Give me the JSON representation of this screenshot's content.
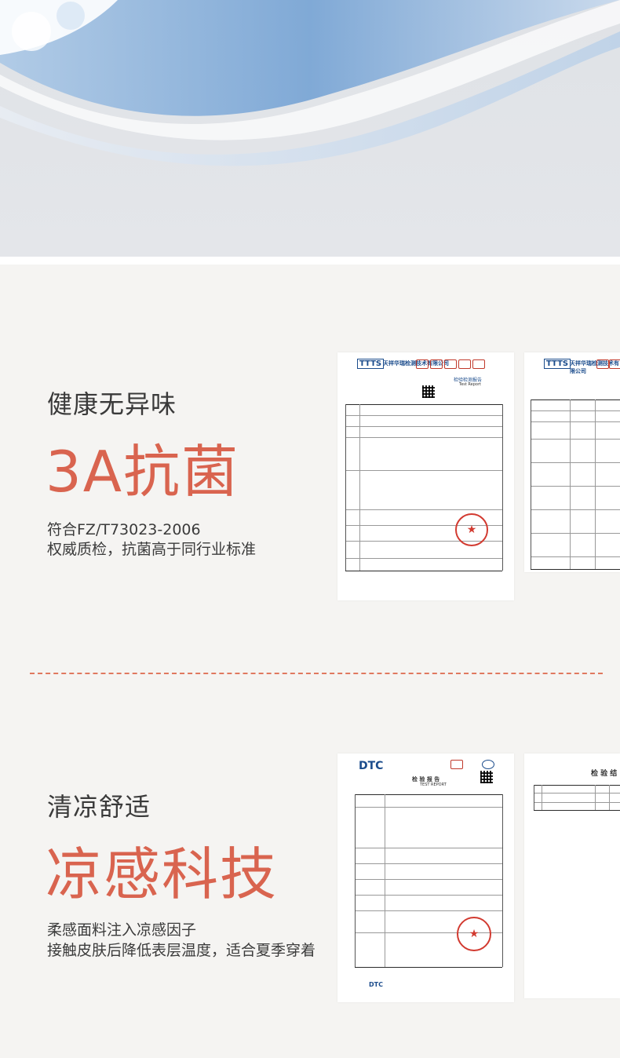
{
  "section1": {
    "subtitle": "健康无异味",
    "headline": "3A抗菌",
    "desc_line1": "符合FZ/T73023-2006",
    "desc_line2": "权威质检，抗菌高于同行业标准"
  },
  "section2": {
    "subtitle": "清凉舒适",
    "headline": "凉感科技",
    "desc_line1": "柔感面料注入凉感因子",
    "desc_line2": "接触皮肤后降低表层温度，适合夏季穿着"
  },
  "doc1": {
    "logo": "TTTS",
    "company": "天祥华瑞检测技术有限公司",
    "report_title": "检验检测报告",
    "report_sub": "Test Report"
  },
  "doc2": {
    "logo": "TTTS",
    "company": "天祥华瑞检测技术有限公司"
  },
  "doc3": {
    "logo": "DTC",
    "report_title": "检 验 报 告",
    "report_sub": "TEST REPORT"
  },
  "doc4": {
    "report_title": "检 验 结"
  },
  "colors": {
    "accent": "#d9644f",
    "text": "#3a3a3a",
    "background": "#f5f4f2",
    "stamp": "#d23a30",
    "doc_blue": "#1b4c8c"
  }
}
